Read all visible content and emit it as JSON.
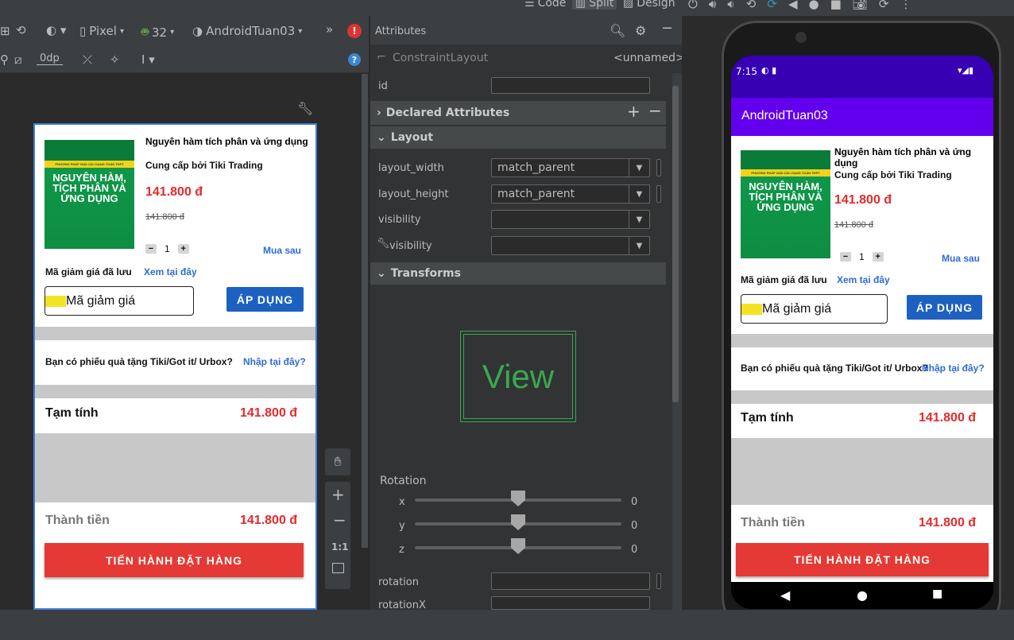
{
  "toolbar": {
    "code_label": "Code",
    "split_label": "Split",
    "design_label": "Design",
    "device_label": "Pixel",
    "api_label": "32",
    "app_label": "AndroidTuan03",
    "margin_label": "0dp",
    "more_label": "»"
  },
  "attributes": {
    "panel_title": "Attributes",
    "component": "ConstraintLayout",
    "component_id": "<unnamed>",
    "id_label": "id",
    "declared_section": "Declared Attributes",
    "layout_section": "Layout",
    "layout_width_label": "layout_width",
    "layout_width_value": "match_parent",
    "layout_height_label": "layout_height",
    "layout_height_value": "match_parent",
    "visibility_label": "visibility",
    "tools_visibility_label": "visibility",
    "transforms_section": "Transforms",
    "view_preview": "View",
    "rotation_title": "Rotation",
    "rotation_x_label": "x",
    "rotation_y_label": "y",
    "rotation_z_label": "z",
    "rotation_x_value": "0",
    "rotation_y_value": "0",
    "rotation_z_value": "0",
    "rotation_label": "rotation",
    "rotationx_label": "rotationX"
  },
  "zoom": {
    "one_to_one": "1:1"
  },
  "product": {
    "book_cover_title": "NGUYÊN HÀM, TÍCH PHÂN VÀ ỨNG DỤNG",
    "book_cover_banner": "PHƯƠNG PHÁP GIẢI CÁC DẠNG TOÁN THPT",
    "name": "Nguyên hàm tích phân và ứng dụng",
    "supplier": "Cung cấp bởi Tiki Trading",
    "price": "141.800 đ",
    "old_price": "141.800 đ",
    "quantity": "1",
    "minus": "−",
    "plus": "+",
    "buy_later": "Mua sau",
    "saved_coupon": "Mã giảm giá đã lưu",
    "view_here": "Xem tại đây",
    "coupon_placeholder": "Mã giảm giá",
    "apply": "ÁP DỤNG",
    "gift_question": "Bạn có phiếu quà tặng Tiki/Got it/ Urbox?",
    "enter_here": "Nhập tại đây?",
    "subtotal_label": "Tạm tính",
    "subtotal_value": "141.800 đ",
    "total_label": "Thành tiền",
    "total_value": "141.800 đ",
    "checkout": "TIẾN HÀNH ĐẶT HÀNG"
  },
  "emulator": {
    "time": "7:15",
    "app_title": "AndroidTuan03"
  },
  "colors": {
    "accent_purple": "#6200ee",
    "price_red": "#e32b2b",
    "button_blue": "#1d61c0",
    "checkout_red": "#e53935",
    "link_blue": "#2f6bd6"
  }
}
